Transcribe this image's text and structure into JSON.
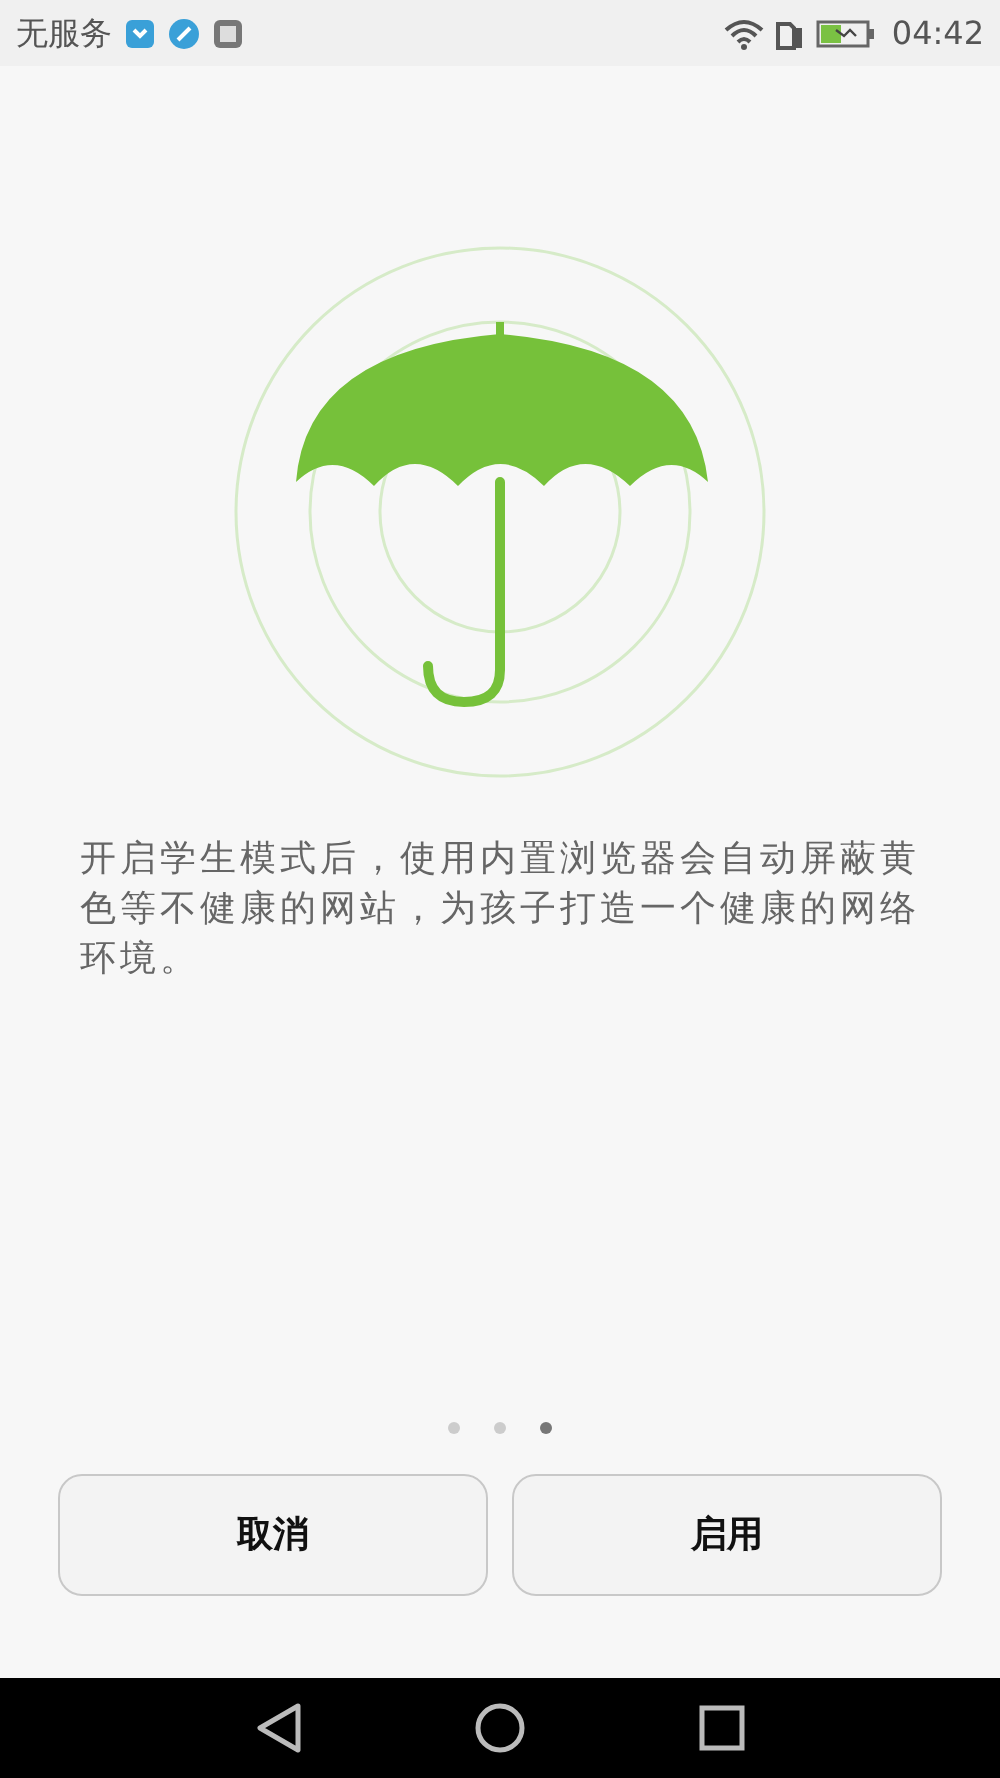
{
  "status_bar": {
    "carrier": "无服务",
    "time": "04:42"
  },
  "description": "开启学生模式后，使用内置浏览器会自动屏蔽黄色等不健康的网站，为孩子打造一个健康的网络环境。",
  "pager": [
    {
      "selected": false
    },
    {
      "selected": false
    },
    {
      "selected": true
    }
  ],
  "buttons": [
    "取消",
    "启用"
  ]
}
